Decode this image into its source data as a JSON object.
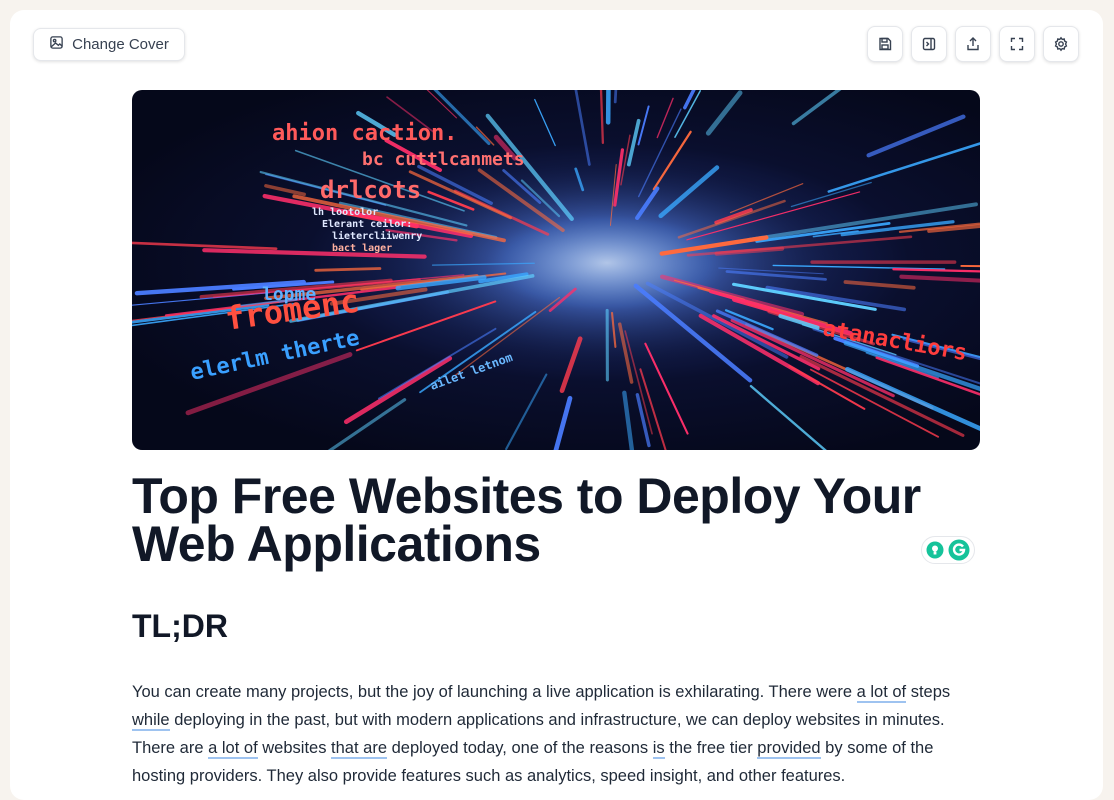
{
  "toolbar": {
    "change_cover_label": "Change Cover",
    "icons": [
      "image-icon",
      "save-icon",
      "panel-right-icon",
      "share-icon",
      "fullscreen-icon",
      "settings-icon"
    ]
  },
  "cover": {
    "texts": [
      "ahion caction.",
      "bc cuttlcanmets",
      "drlcots",
      "lh lootolor",
      "Elerant ceilor:",
      "lietercliiwenry",
      "bact lager",
      "lopme",
      "fromenc",
      "elerlm therte",
      "atanacliors",
      "ailet letnom"
    ]
  },
  "article": {
    "title": "Top Free Websites to Deploy Your Web Applications",
    "heading": "TL;DR",
    "paragraph": [
      {
        "text": "You can create many projects, but the joy of launching a live application is exhilarating. There were ",
        "u": false
      },
      {
        "text": "a lot of",
        "u": true
      },
      {
        "text": " steps ",
        "u": false
      },
      {
        "text": "while",
        "u": true
      },
      {
        "text": " deploying in the past, but with modern applications and infrastructure, we can deploy websites in minutes. There are ",
        "u": false
      },
      {
        "text": "a lot of",
        "u": true
      },
      {
        "text": " websites ",
        "u": false
      },
      {
        "text": "that are",
        "u": true
      },
      {
        "text": " deployed today, one of the reasons ",
        "u": false
      },
      {
        "text": "is",
        "u": true
      },
      {
        "text": " the free tier ",
        "u": false
      },
      {
        "text": "provided",
        "u": true
      },
      {
        "text": " by some of the hosting providers. They also provide features such as analytics, speed insight, and other features.",
        "u": false
      }
    ]
  },
  "colors": {
    "accent_underline": "#9ec3f0",
    "grammarly_green": "#15c39a",
    "title": "#111827"
  }
}
